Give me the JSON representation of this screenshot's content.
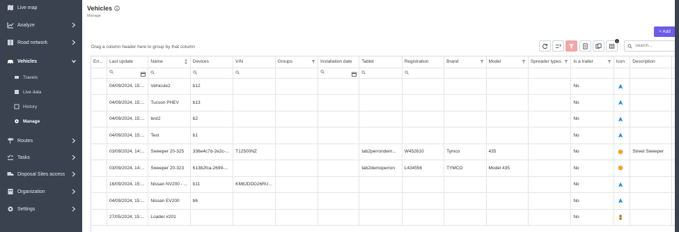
{
  "sidebar": {
    "items": [
      {
        "label": "Live map",
        "icon": "map-icon"
      },
      {
        "label": "Analyze",
        "icon": "chart-line-icon"
      },
      {
        "label": "Road network",
        "icon": "road-icon"
      },
      {
        "label": "Vehicles",
        "icon": "car-icon"
      },
      {
        "label": "Routes",
        "icon": "signpost-icon"
      },
      {
        "label": "Tasks",
        "icon": "tasks-icon"
      },
      {
        "label": "Disposal Sites access",
        "icon": "truck-icon"
      },
      {
        "label": "Organization",
        "icon": "building-icon"
      },
      {
        "label": "Settings",
        "icon": "gear-icon"
      }
    ],
    "vehicles_sub": [
      {
        "label": "Travels",
        "icon": "route-icon"
      },
      {
        "label": "Live data",
        "icon": "data-icon"
      },
      {
        "label": "History",
        "icon": "history-icon"
      },
      {
        "label": "Manage",
        "icon": "cog-icon"
      }
    ]
  },
  "header": {
    "title": "Vehicles",
    "subtitle": "Manage",
    "add_label": "+ Add",
    "group_hint": "Drag a column header here to group by that column",
    "search_placeholder": "Search...",
    "badge_count": "1"
  },
  "colors": {
    "sidebar_bg": "#3a4250",
    "accent": "#6c5ce7",
    "filter_active": "#f4a6a6",
    "marker_blue": "#1e88e5",
    "marker_orange": "#f0a030"
  },
  "table": {
    "columns": [
      "Err...",
      "Last update",
      "Name",
      "Devices",
      "VIN",
      "Groups",
      "Installation date",
      "Tablet",
      "Registration",
      "Brand",
      "Model",
      "Spreader types",
      "Is a trailer",
      "Icon",
      "Description",
      ""
    ],
    "rows": [
      {
        "err": "",
        "last_update": "04/09/2024, 15:...",
        "name": "Vehicule2",
        "devices": "b12",
        "vin": "",
        "groups": "",
        "installation": "",
        "tablet": "",
        "registration": "",
        "brand": "",
        "model": "",
        "spreader": "",
        "trailer": "No",
        "icon": "blue-arrow",
        "description": ""
      },
      {
        "err": "",
        "last_update": "04/09/2024, 15:...",
        "name": "Tucson PHEV",
        "devices": "b13",
        "vin": "",
        "groups": "",
        "installation": "",
        "tablet": "",
        "registration": "",
        "brand": "",
        "model": "",
        "spreader": "",
        "trailer": "No",
        "icon": "blue-arrow",
        "description": ""
      },
      {
        "err": "",
        "last_update": "04/09/2024, 15:...",
        "name": "test2",
        "devices": "b2",
        "vin": "",
        "groups": "",
        "installation": "",
        "tablet": "",
        "registration": "",
        "brand": "",
        "model": "",
        "spreader": "",
        "trailer": "No",
        "icon": "blue-arrow",
        "description": ""
      },
      {
        "err": "",
        "last_update": "04/09/2024, 15:...",
        "name": "Test",
        "devices": "b1",
        "vin": "",
        "groups": "",
        "installation": "",
        "tablet": "",
        "registration": "",
        "brand": "",
        "model": "",
        "spreader": "",
        "trailer": "No",
        "icon": "blue-arrow",
        "description": ""
      },
      {
        "err": "",
        "last_update": "03/09/2024, 14:...",
        "name": "Sweeper 20-325",
        "devices": "338e4c7d-2e2c-...",
        "vin": "T12500NZ",
        "groups": "",
        "installation": "",
        "tablet": "tab2perrondem...",
        "registration": "W452610",
        "brand": "Tymco",
        "model": "435",
        "spreader": "",
        "trailer": "No",
        "icon": "orange-dot",
        "description": "Street Sweeper"
      },
      {
        "err": "",
        "last_update": "03/09/2024, 14:...",
        "name": "Sweeper 20-323",
        "devices": "613b2fca-2699-...",
        "vin": "",
        "groups": "",
        "installation": "",
        "tablet": "tab2demoperron",
        "registration": "L434556",
        "brand": "TYMCO",
        "model": "Model 435",
        "spreader": "",
        "trailer": "No",
        "icon": "orange-dot",
        "description": ""
      },
      {
        "err": "",
        "last_update": "16/09/2024, 15:...",
        "name": "Nissan NV200 - ...",
        "devices": "b11",
        "vin": "KM8JDDD26RU...",
        "groups": "",
        "installation": "",
        "tablet": "",
        "registration": "",
        "brand": "",
        "model": "",
        "spreader": "",
        "trailer": "No",
        "icon": "blue-arrow",
        "description": ""
      },
      {
        "err": "",
        "last_update": "04/09/2024, 15:...",
        "name": "Nissan EV200",
        "devices": "b6",
        "vin": "",
        "groups": "",
        "installation": "",
        "tablet": "",
        "registration": "",
        "brand": "",
        "model": "",
        "spreader": "",
        "trailer": "No",
        "icon": "blue-arrow",
        "description": ""
      },
      {
        "err": "",
        "last_update": "27/05/2024, 15:...",
        "name": "Loader #201",
        "devices": "",
        "vin": "",
        "groups": "",
        "installation": "",
        "tablet": "",
        "registration": "",
        "brand": "",
        "model": "",
        "spreader": "",
        "trailer": "No",
        "icon": "loader-marker",
        "description": ""
      }
    ]
  }
}
